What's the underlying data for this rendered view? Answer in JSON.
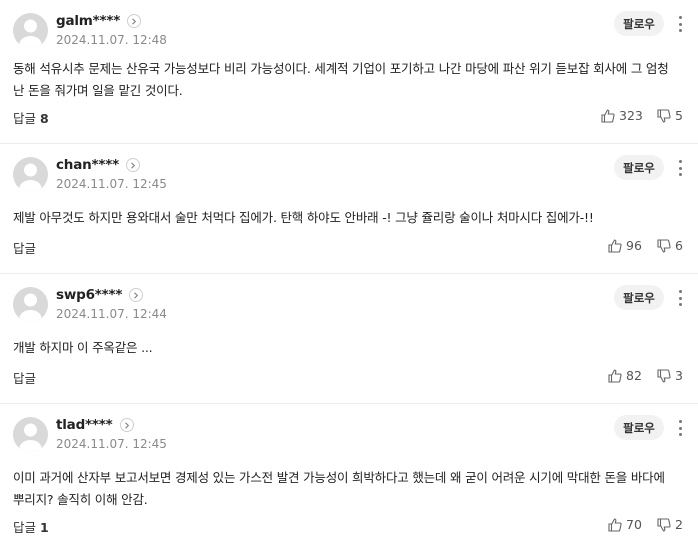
{
  "comments": [
    {
      "nick": "galm****",
      "date": "2024.11.07. 12:48",
      "follow": "팔로우",
      "body": "동해 석유시추 문제는 산유국 가능성보다 비리 가능성이다. 세계적 기업이 포기하고 나간 마당에 파산 위기 듣보잡 회사에 그 엄청난 돈을 줘가며 일을 맡긴 것이다.",
      "reply_label": "답글",
      "reply_count": "8",
      "likes": "323",
      "dislikes": "5"
    },
    {
      "nick": "chan****",
      "date": "2024.11.07. 12:45",
      "follow": "팔로우",
      "body": "제발 아무것도 하지만 용와대서 술만 처먹다 집에가. 탄핵 하야도 안바래 -! 그냥 쥴리랑 술이나 처마시다 집에가-!!",
      "reply_label": "답글",
      "reply_count": "",
      "likes": "96",
      "dislikes": "6"
    },
    {
      "nick": "swp6****",
      "date": "2024.11.07. 12:44",
      "follow": "팔로우",
      "body": "개발 하지마 이 주옥같은 ...",
      "reply_label": "답글",
      "reply_count": "",
      "likes": "82",
      "dislikes": "3"
    },
    {
      "nick": "tlad****",
      "date": "2024.11.07. 12:45",
      "follow": "팔로우",
      "body": "이미 과거에 산자부 보고서보면 경제성 있는 가스전 발견 가능성이 희박하다고 했는데 왜 굳이 어려운 시기에 막대한 돈을 바다에 뿌리지? 솔직히 이해 안감.",
      "reply_label": "답글",
      "reply_count": "1",
      "likes": "70",
      "dislikes": "2"
    }
  ],
  "icons": {
    "profile": "user-silhouette-icon",
    "expand": "chevron-right-icon",
    "menu": "more-vertical-icon",
    "like": "thumbs-up-icon",
    "dislike": "thumbs-down-icon"
  }
}
